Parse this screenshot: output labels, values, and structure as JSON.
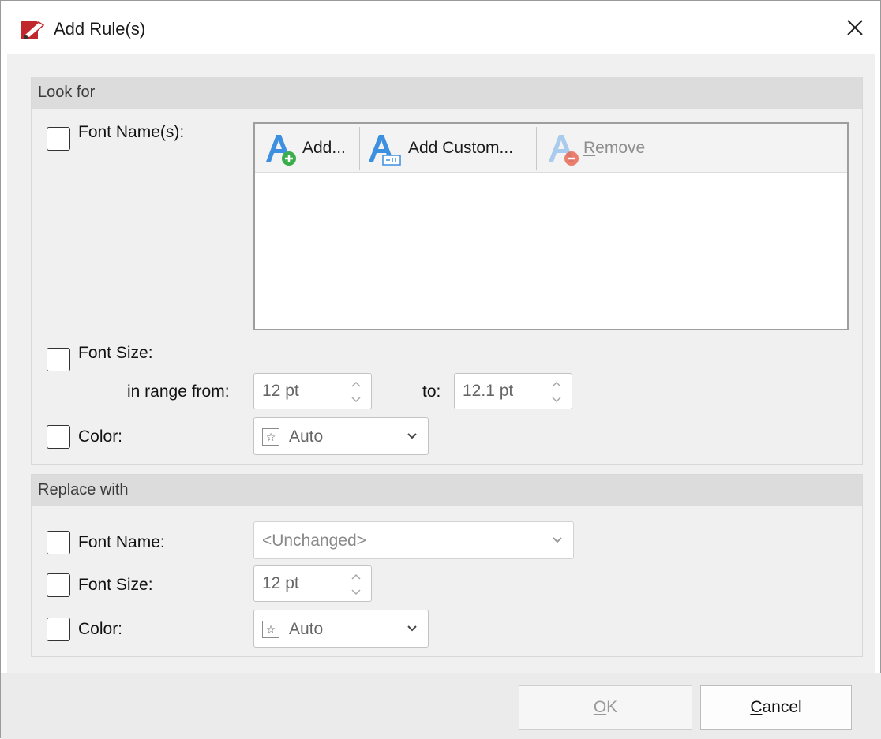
{
  "window": {
    "title": "Add Rule(s)",
    "close_icon": "close-icon",
    "app_icon": "pen-app-icon"
  },
  "look_for": {
    "header": "Look for",
    "font_names": {
      "label": "Font Name(s):",
      "checked": false,
      "toolbar": {
        "add": {
          "label": "Add...",
          "icon": "font-add-icon"
        },
        "add_custom": {
          "label": "Add Custom...",
          "icon": "font-custom-icon"
        },
        "remove": {
          "label_accel": "R",
          "label_rest": "emove",
          "icon": "font-remove-icon",
          "disabled": true
        }
      },
      "items": []
    },
    "font_size": {
      "label": "Font Size:",
      "checked": false,
      "range_label": "in range from:",
      "from_value": "12 pt",
      "to_label": "to:",
      "to_value": "12.1 pt"
    },
    "color": {
      "label": "Color:",
      "checked": false,
      "value": "Auto"
    }
  },
  "replace_with": {
    "header": "Replace with",
    "font_name": {
      "label": "Font Name:",
      "checked": false,
      "value": "<Unchanged>"
    },
    "font_size": {
      "label": "Font Size:",
      "checked": false,
      "value": "12 pt"
    },
    "color": {
      "label": "Color:",
      "checked": false,
      "value": "Auto"
    }
  },
  "buttons": {
    "ok": {
      "accel": "O",
      "rest": "K",
      "disabled": true
    },
    "cancel": {
      "accel": "C",
      "rest": "ancel"
    }
  },
  "colors": {
    "accent_blue": "#3d8fe0",
    "add_green": "#3aae4a",
    "remove_red": "#e8604a",
    "app_red": "#c0282d"
  }
}
